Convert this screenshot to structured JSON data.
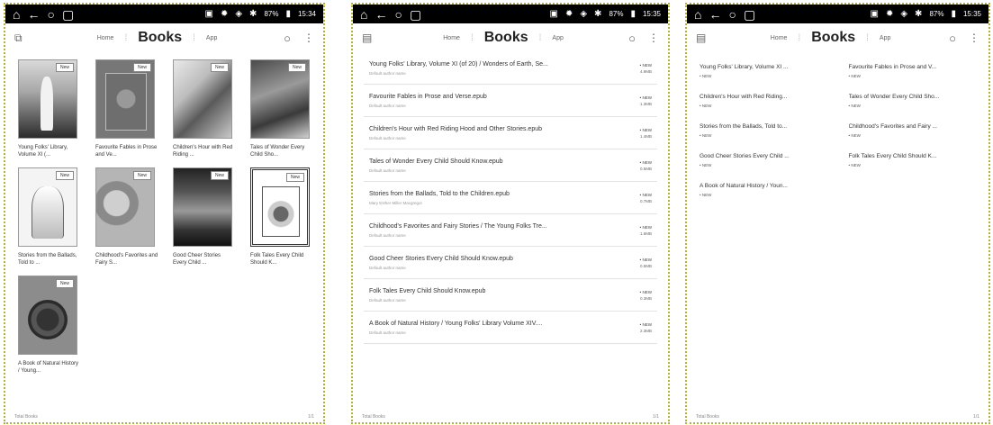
{
  "statusbar": {
    "screen1": {
      "battery": "87%",
      "time": "15:34"
    },
    "screen2": {
      "battery": "87%",
      "time": "15:35"
    },
    "screen3": {
      "battery": "87%",
      "time": "15:35"
    }
  },
  "header": {
    "home_label": "Home",
    "title": "Books",
    "app_label": "App"
  },
  "footer": {
    "left": "Total Books",
    "page": "1/1"
  },
  "grid_view": {
    "badge": "New",
    "books": [
      {
        "title": "Young Folks' Library, Volume XI (..."
      },
      {
        "title": "Favourite Fables in Prose and Ve..."
      },
      {
        "title": "Children's Hour with Red Riding ..."
      },
      {
        "title": "Tales of Wonder Every Child Sho..."
      },
      {
        "title": "Stories from the Ballads, Told to ..."
      },
      {
        "title": "Childhood's Favorites and Fairy S..."
      },
      {
        "title": "Good Cheer Stories Every Child ..."
      },
      {
        "title": "Folk Tales Every Child Should K..."
      },
      {
        "title": "A Book of Natural History / Young..."
      }
    ]
  },
  "detail_view": {
    "new_label": "• NEW",
    "books": [
      {
        "title": "Young Folks' Library, Volume XI (of 20) / Wonders of Earth, Se...",
        "author": "Default author name",
        "size": "4.9MB"
      },
      {
        "title": "Favourite Fables in Prose and Verse.epub",
        "author": "Default author name",
        "size": "1.3MB"
      },
      {
        "title": "Children's Hour with Red Riding Hood and Other Stories.epub",
        "author": "Default author name",
        "size": "1.4MB"
      },
      {
        "title": "Tales of Wonder Every Child Should Know.epub",
        "author": "Default author name",
        "size": "0.5MB"
      },
      {
        "title": "Stories from the Ballads, Told to the Children.epub",
        "author": "Mary Esther Miller Macgregor",
        "size": "0.7MB"
      },
      {
        "title": "Childhood's Favorites and Fairy Stories / The Young Folks Tre...",
        "author": "Default author name",
        "size": "1.6MB"
      },
      {
        "title": "Good Cheer Stories Every Child Should Know.epub",
        "author": "Default author name",
        "size": "0.5MB"
      },
      {
        "title": "Folk Tales Every Child Should Know.epub",
        "author": "Default author name",
        "size": "0.3MB"
      },
      {
        "title": "A Book of Natural History / Young Folks' Library Volume XIV....",
        "author": "Default author name",
        "size": "2.3MB"
      }
    ]
  },
  "compact_view": {
    "new_label": "• NEW",
    "books": [
      {
        "title": "Young Folks' Library, Volume XI ..."
      },
      {
        "title": "Favourite Fables in Prose and V..."
      },
      {
        "title": "Children's Hour with Red Riding..."
      },
      {
        "title": "Tales of Wonder Every Child Sho..."
      },
      {
        "title": "Stories from the Ballads, Told to..."
      },
      {
        "title": "Childhood's Favorites and Fairy ..."
      },
      {
        "title": "Good Cheer Stories Every Child ..."
      },
      {
        "title": "Folk Tales Every Child Should K..."
      },
      {
        "title": "A Book of Natural History / Youn..."
      }
    ]
  }
}
